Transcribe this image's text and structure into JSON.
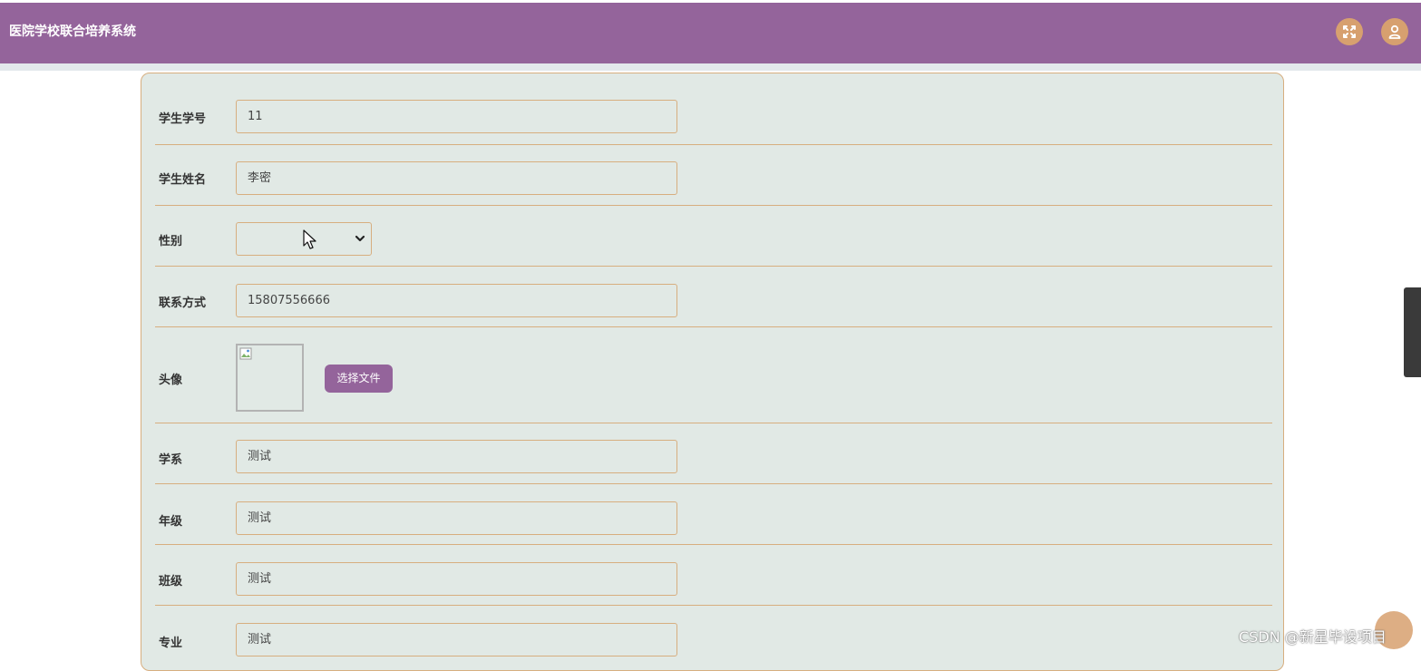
{
  "header": {
    "app_title": "医院学校联合培养系统",
    "accent_color": "#94649b",
    "button_color": "#d7a06f",
    "icons": [
      "fullscreen-icon",
      "user-icon"
    ]
  },
  "form": {
    "fields": [
      {
        "label": "学生学号",
        "value": "11"
      },
      {
        "label": "学生姓名",
        "value": "李密"
      },
      {
        "label": "性别",
        "value": ""
      },
      {
        "label": "联系方式",
        "value": "15807556666"
      },
      {
        "label": "头像",
        "button_label": "选择文件"
      },
      {
        "label": "学系",
        "value": "测试"
      },
      {
        "label": "年级",
        "value": "测试"
      },
      {
        "label": "班级",
        "value": "测试"
      },
      {
        "label": "专业",
        "value": "测试"
      }
    ],
    "border_color": "#d7ae7f",
    "background_color": "#e1e9e5"
  },
  "watermark": "CSDN @新星毕设项目"
}
